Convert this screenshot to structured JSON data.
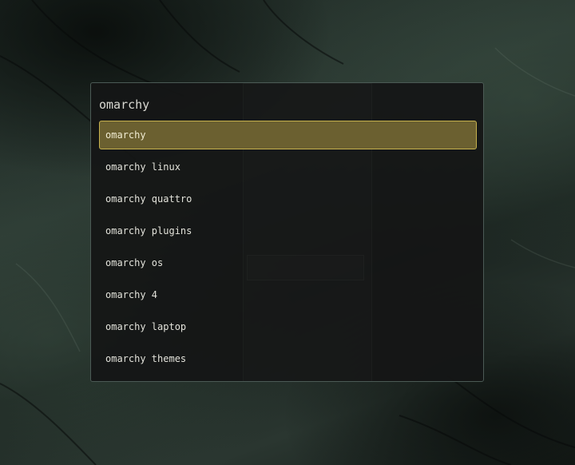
{
  "search": {
    "query": "omarchy"
  },
  "results": [
    {
      "label": "omarchy",
      "selected": true
    },
    {
      "label": "omarchy linux",
      "selected": false
    },
    {
      "label": "omarchy quattro",
      "selected": false
    },
    {
      "label": "omarchy plugins",
      "selected": false
    },
    {
      "label": "omarchy os",
      "selected": false
    },
    {
      "label": "omarchy 4",
      "selected": false
    },
    {
      "label": "omarchy laptop",
      "selected": false
    },
    {
      "label": "omarchy themes",
      "selected": false
    }
  ],
  "colors": {
    "selected_background": "#6b6030",
    "selected_border": "#c7b24e",
    "launcher_background": "#141516",
    "launcher_border": "#4b5a55",
    "text": "#e2e2da"
  }
}
